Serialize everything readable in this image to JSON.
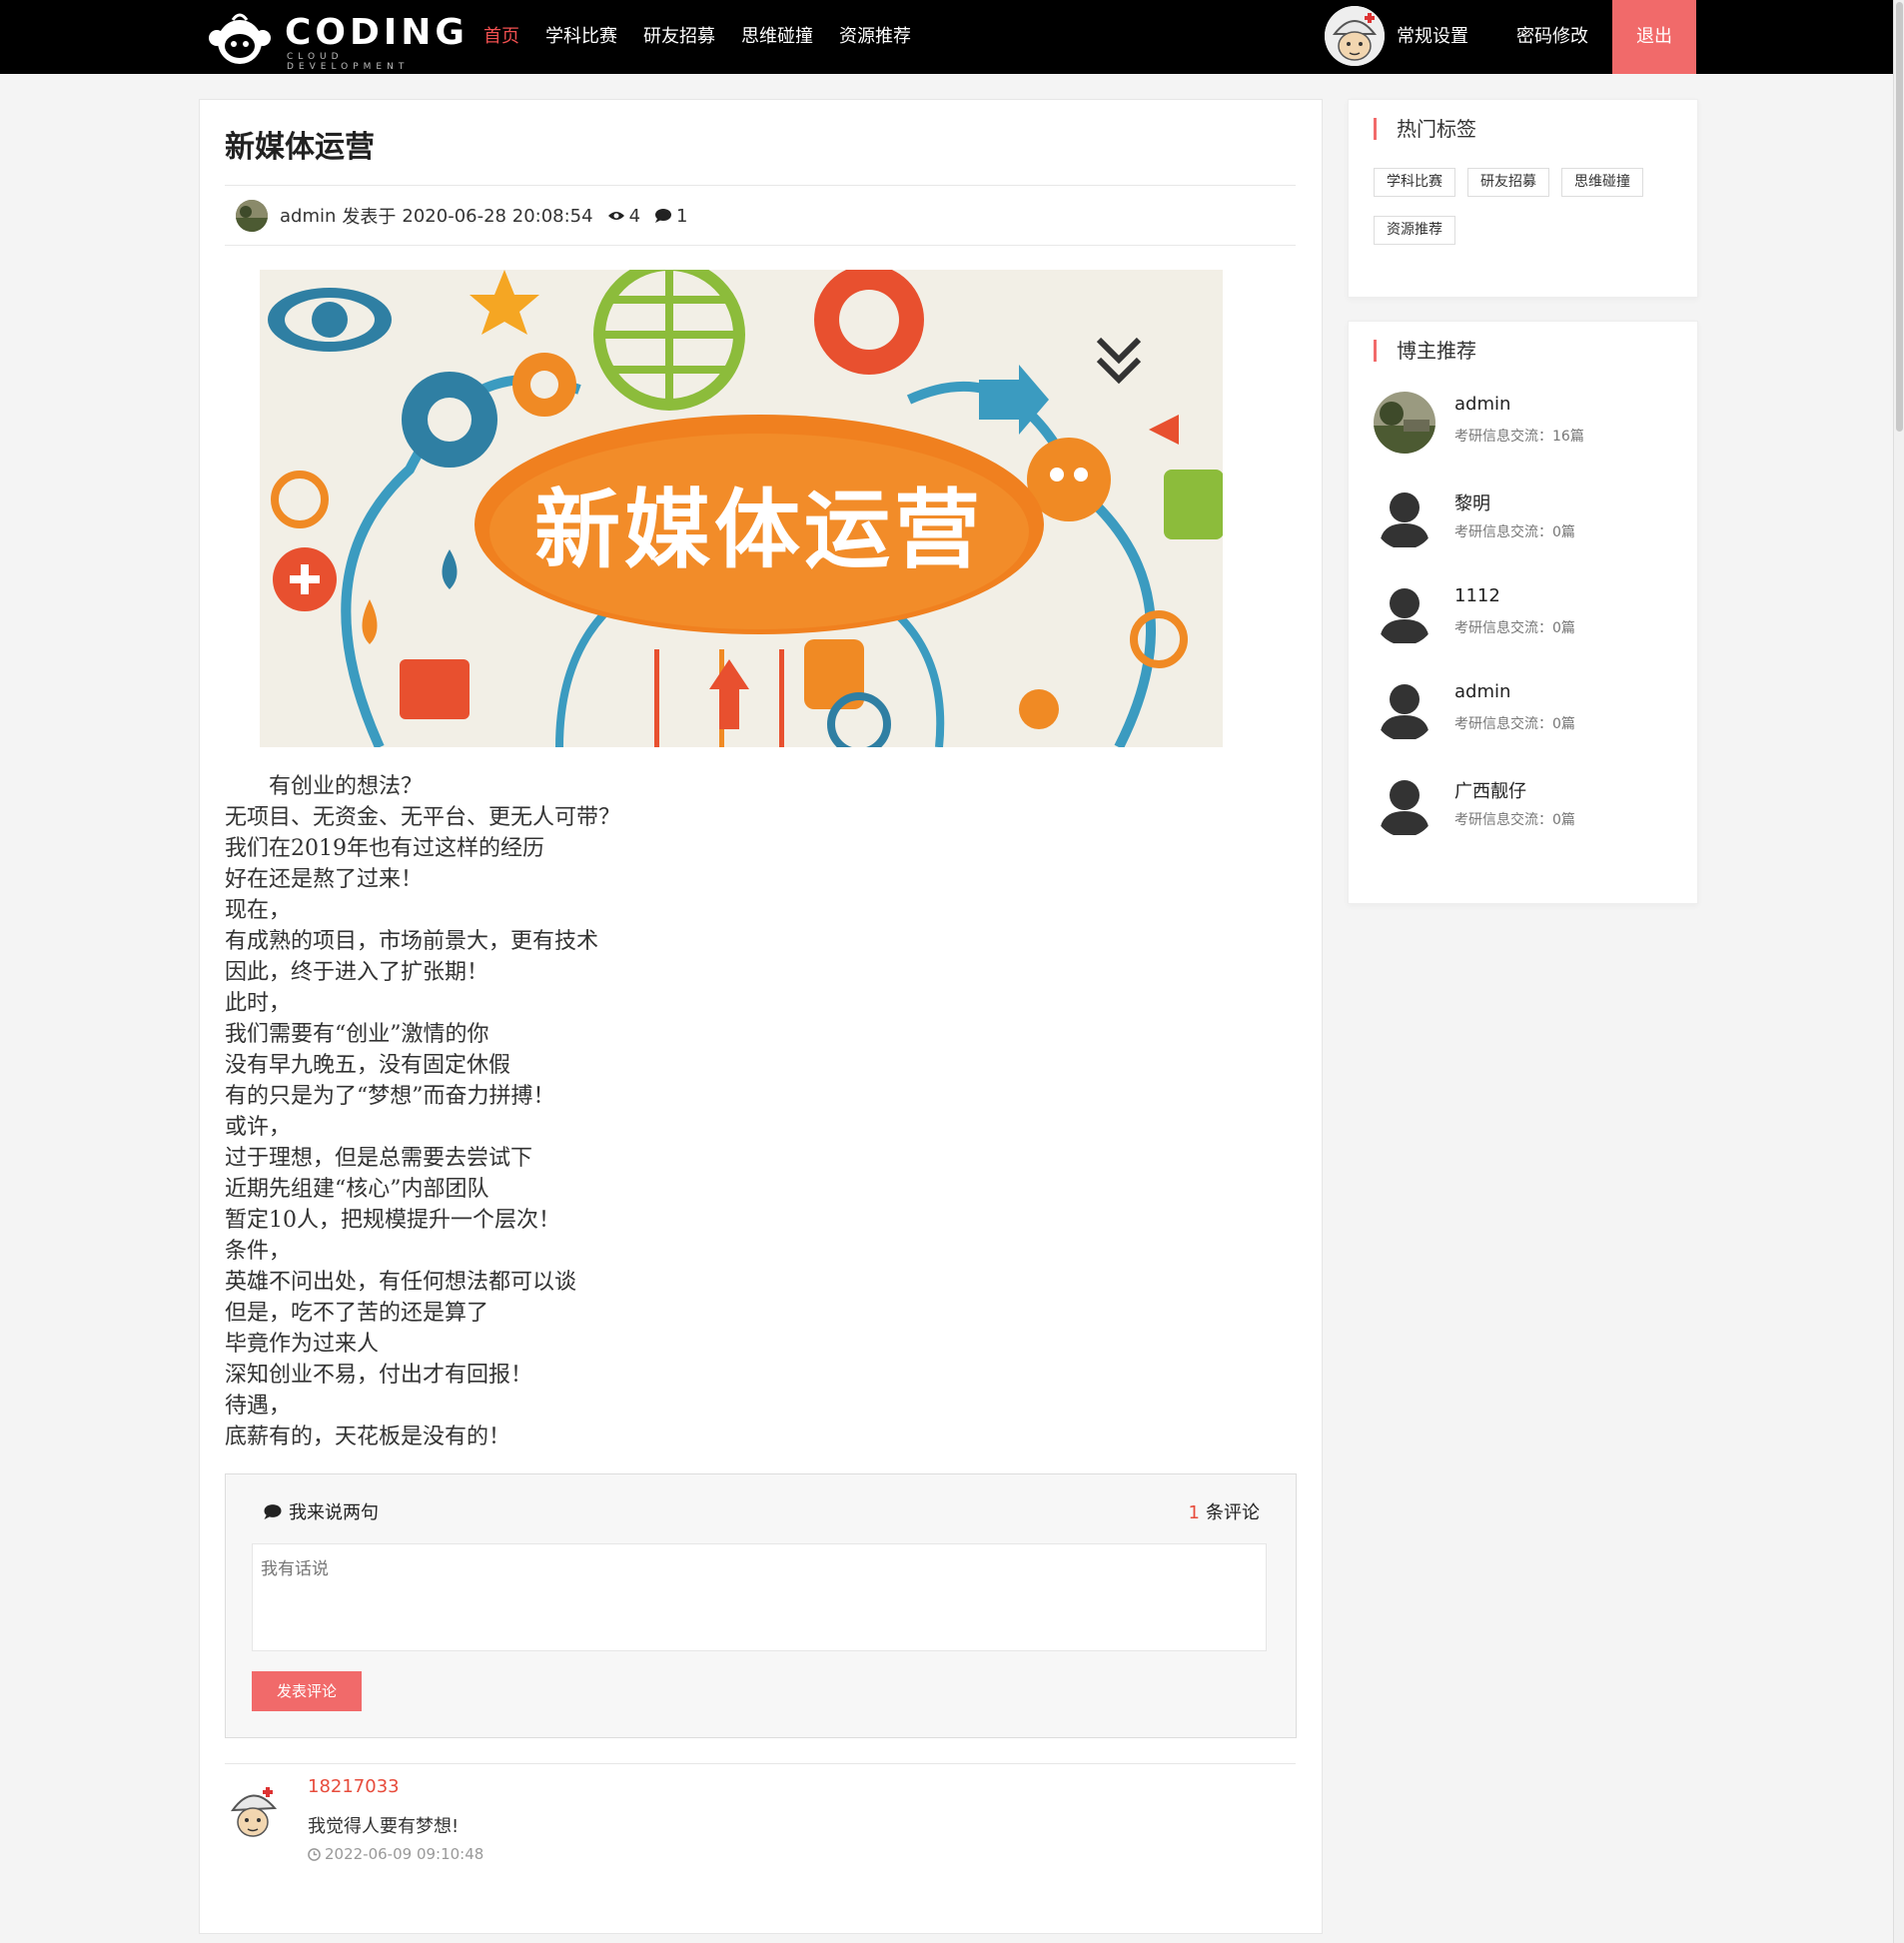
{
  "nav": {
    "logo_text": "CODING",
    "logo_sub": "CLOUD DEVELOPMENT",
    "menu": [
      "首页",
      "学科比赛",
      "研友招募",
      "思维碰撞",
      "资源推荐"
    ],
    "settings": "常规设置",
    "password": "密码修改",
    "logout": "退出",
    "colors": {
      "bar": "#000000",
      "accent": "#f05050",
      "logout_bg": "#f16a6a"
    }
  },
  "article": {
    "title": "新媒体运营",
    "author": "admin",
    "posted_label": "发表于",
    "date": "2020-06-28 20:08:54",
    "views": "4",
    "comments": "1",
    "banner_text": "新媒体运营",
    "body": "　　有创业的想法？\n无项目、无资金、无平台、更无人可带？\n我们在2019年也有过这样的经历\n好在还是熬了过来！\n现在，\n有成熟的项目，市场前景大，更有技术\n因此，终于进入了扩张期！\n此时，\n我们需要有“创业”激情的你\n没有早九晚五，没有固定休假\n有的只是为了“梦想”而奋力拼搏！\n或许，\n过于理想，但是总需要去尝试下\n近期先组建“核心”内部团队\n暂定10人，把规模提升一个层次！\n条件，\n英雄不问出处，有任何想法都可以谈\n但是，吃不了苦的还是算了\n毕竟作为过来人\n深知创业不易，付出才有回报！\n待遇，\n底薪有的，天花板是没有的！"
  },
  "comment_form": {
    "heading": "我来说两句",
    "count": "1",
    "count_label": "条评论",
    "placeholder": "我有话说",
    "submit": "发表评论"
  },
  "comments": [
    {
      "user": "18217033",
      "text": "我觉得人要有梦想!",
      "time": "2022-06-09 09:10:48"
    }
  ],
  "sidebar": {
    "hot_tags_title": "热门标签",
    "tags": [
      "学科比赛",
      "研友招募",
      "思维碰撞",
      "资源推荐"
    ],
    "bloggers_title": "博主推荐",
    "bloggers": [
      {
        "name": "admin",
        "desc": "考研信息交流：16篇"
      },
      {
        "name": "黎明",
        "desc": "考研信息交流：0篇"
      },
      {
        "name": "1112",
        "desc": "考研信息交流：0篇"
      },
      {
        "name": "admin",
        "desc": "考研信息交流：0篇"
      },
      {
        "name": "广西靓仔",
        "desc": "考研信息交流：0篇"
      }
    ]
  }
}
